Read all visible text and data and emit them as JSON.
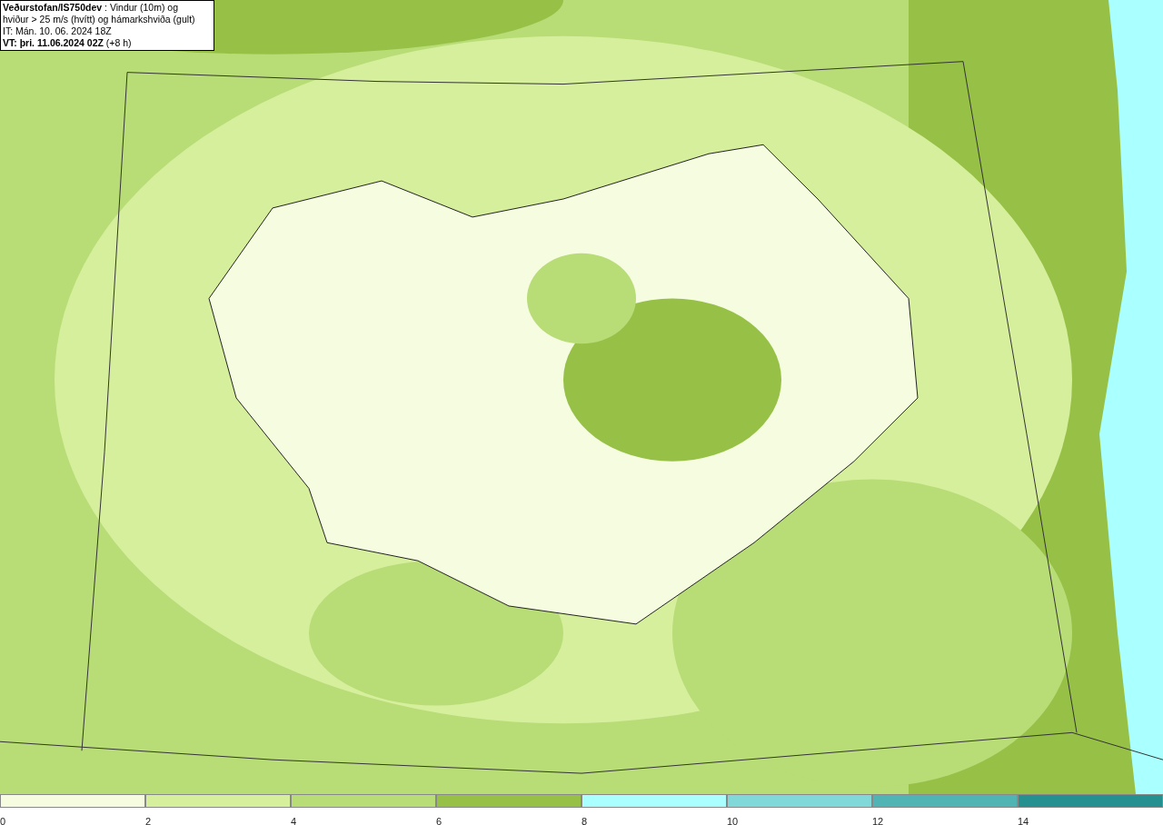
{
  "header": {
    "lines": [
      "**Veðurstofan/IS750dev** : Vindur (10m) og",
      "hviður > 25 m/s (hvítt) og hámarkshviða (gult)",
      "IT: Mán. 10. 06. 2024 18Z",
      "**VT: þri. 11.06.2024 02Z** (+8 h)"
    ]
  },
  "legend": {
    "bins": [
      {
        "label": "0",
        "color": "#f5fce0"
      },
      {
        "label": "2",
        "color": "#d6ef9c"
      },
      {
        "label": "4",
        "color": "#b8dc76"
      },
      {
        "label": "6",
        "color": "#96c046"
      },
      {
        "label": "8",
        "color": "#aaffff"
      },
      {
        "label": "10",
        "color": "#80d8d8"
      },
      {
        "label": "12",
        "color": "#50b4b4"
      },
      {
        "label": "14",
        "color": "#249090"
      }
    ]
  }
}
